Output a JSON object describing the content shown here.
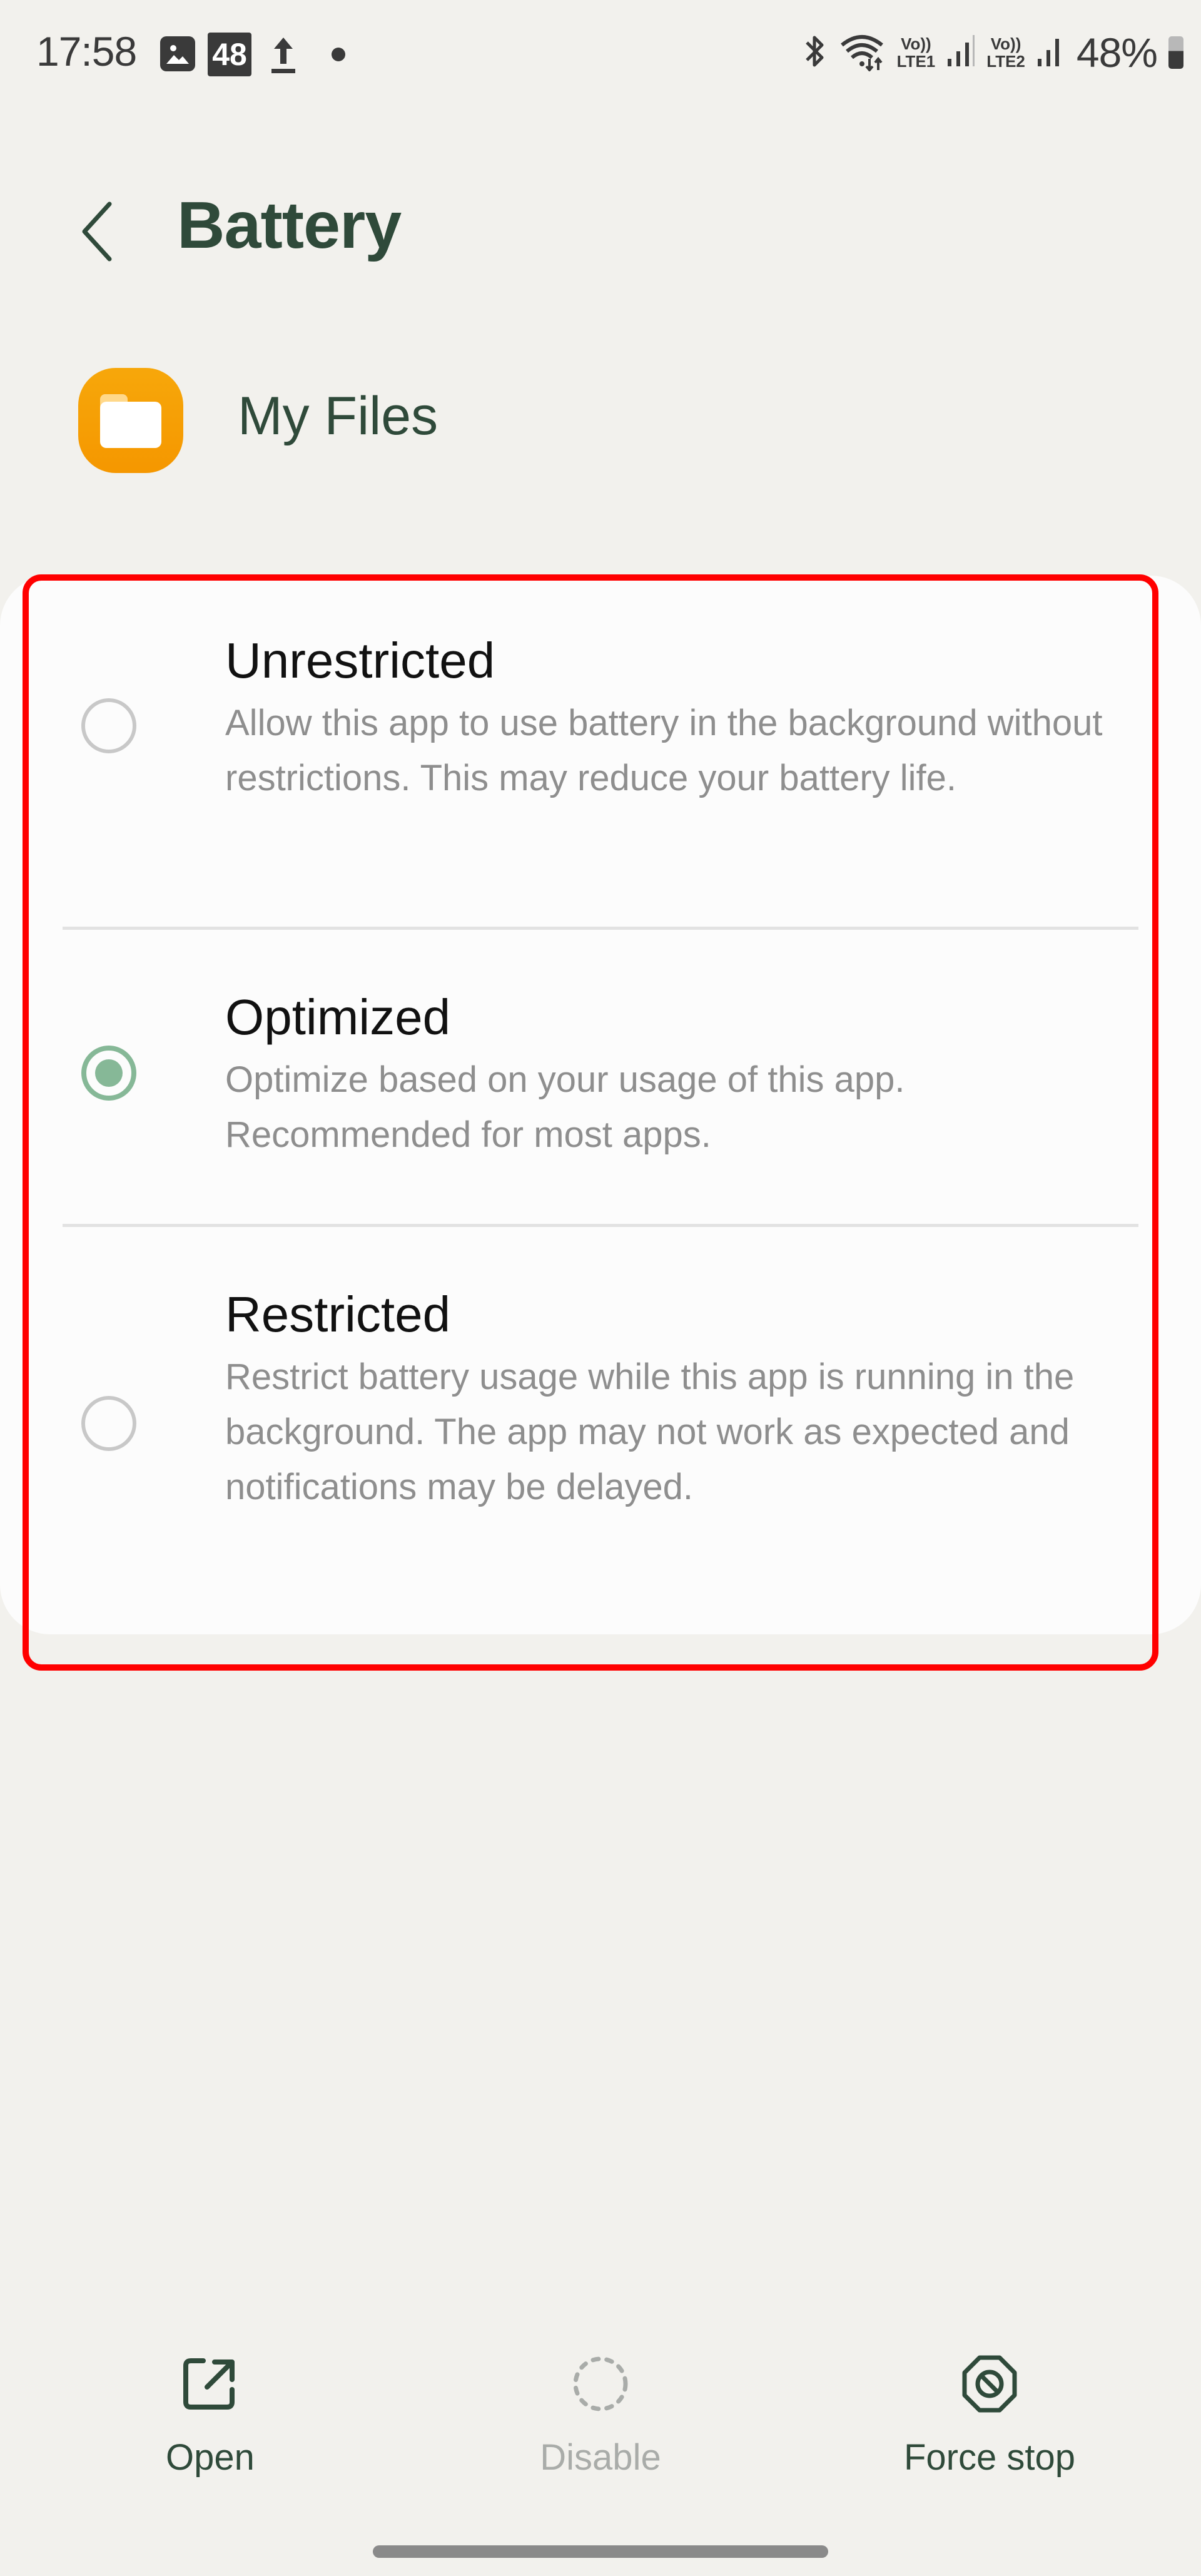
{
  "status_bar": {
    "time": "17:58",
    "notification_icons": [
      "gallery-icon",
      "badge-48-icon",
      "upload-icon",
      "dot-icon"
    ],
    "badge_text": "48",
    "sim1_label_top": "Vo))",
    "sim1_label_bottom": "LTE1",
    "sim2_label_top": "Vo))",
    "sim2_label_bottom": "LTE2",
    "battery_percent": "48%",
    "battery_level": 0.48
  },
  "header": {
    "back_icon": "chevron-left-icon",
    "title": "Battery"
  },
  "app": {
    "icon": "folder-icon",
    "icon_color": "#f7a70a",
    "name": "My Files"
  },
  "options": [
    {
      "title": "Unrestricted",
      "description": "Allow this app to use battery in the background without restrictions. This may reduce your battery life.",
      "selected": false
    },
    {
      "title": "Optimized",
      "description": "Optimize based on your usage of this app. Recommended for most apps.",
      "selected": true
    },
    {
      "title": "Restricted",
      "description": "Restrict battery usage while this app is running in the background. The app may not work as expected and notifications may be delayed.",
      "selected": false
    }
  ],
  "actions": [
    {
      "label": "Open",
      "icon": "open-external-icon",
      "enabled": true
    },
    {
      "label": "Disable",
      "icon": "disable-dashed-circle-icon",
      "enabled": false
    },
    {
      "label": "Force stop",
      "icon": "force-stop-icon",
      "enabled": true
    }
  ],
  "colors": {
    "accent": "#86b897",
    "title_text": "#2f4a3a",
    "highlight_border": "#ff0000",
    "background": "#f2f1ed"
  }
}
